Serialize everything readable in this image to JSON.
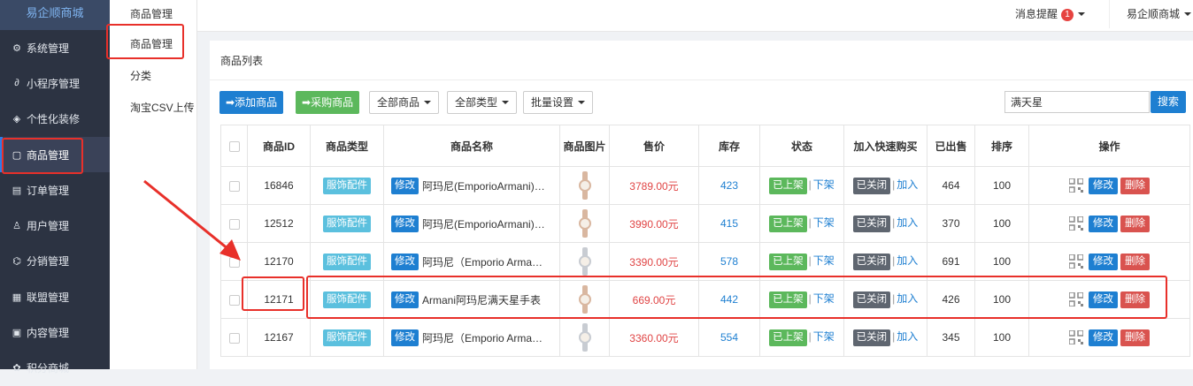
{
  "sidebar": {
    "logo": "易企顺商城",
    "items": [
      {
        "label": "系统管理",
        "icon": "gear-icon",
        "glyph": "⚙",
        "active": false
      },
      {
        "label": "小程序管理",
        "icon": "link-icon",
        "glyph": "∂",
        "active": false
      },
      {
        "label": "个性化装修",
        "icon": "diamond-icon",
        "glyph": "◈",
        "active": false
      },
      {
        "label": "商品管理",
        "icon": "bag-icon",
        "glyph": "▢",
        "active": true
      },
      {
        "label": "订单管理",
        "icon": "clipboard-icon",
        "glyph": "▤",
        "active": false
      },
      {
        "label": "用户管理",
        "icon": "user-icon",
        "glyph": "♙",
        "active": false
      },
      {
        "label": "分销管理",
        "icon": "share-icon",
        "glyph": "⌬",
        "active": false
      },
      {
        "label": "联盟管理",
        "icon": "store-icon",
        "glyph": "▦",
        "active": false
      },
      {
        "label": "内容管理",
        "icon": "document-icon",
        "glyph": "▣",
        "active": false
      },
      {
        "label": "积分商城",
        "icon": "gift-icon",
        "glyph": "✿",
        "active": false
      }
    ]
  },
  "subnav": {
    "items": [
      "商品管理",
      "分类",
      "淘宝CSV上传"
    ]
  },
  "topbar": {
    "title": "商品管理",
    "notify_label": "消息提醒",
    "notify_count": "1",
    "account": "易企顺商城"
  },
  "main": {
    "title": "商品列表",
    "buttons": {
      "add": "添加商品",
      "purchase": "采购商品",
      "all_goods": "全部商品",
      "all_types": "全部类型",
      "batch": "批量设置"
    },
    "search": {
      "value": "满天星",
      "button": "搜索"
    }
  },
  "table": {
    "headers": [
      "",
      "商品ID",
      "商品类型",
      "商品名称",
      "商品图片",
      "售价",
      "库存",
      "状态",
      "加入快速购买",
      "已出售",
      "排序",
      "操作"
    ],
    "status_on": "已上架",
    "action_off": "下架",
    "quick_closed": "已关闭",
    "action_add": "加入",
    "edit": "修改",
    "delete": "删除",
    "rows": [
      {
        "id": "16846",
        "type": "服饰配件",
        "name": "阿玛尼(EmporioArmani)女士手表",
        "price": "3789.00元",
        "stock": "423",
        "sold": "464",
        "sort": "100",
        "watch": "rose"
      },
      {
        "id": "12512",
        "type": "服饰配件",
        "name": "阿玛尼(EmporioArmani)女士手表",
        "price": "3990.00元",
        "stock": "415",
        "sold": "370",
        "sort": "100",
        "watch": "rose"
      },
      {
        "id": "12170",
        "type": "服饰配件",
        "name": "阿玛尼（Emporio Armani）女士手表",
        "price": "3390.00元",
        "stock": "578",
        "sold": "691",
        "sort": "100",
        "watch": "silver"
      },
      {
        "id": "12171",
        "type": "服饰配件",
        "name": "Armani阿玛尼满天星手表",
        "price": "669.00元",
        "stock": "442",
        "sold": "426",
        "sort": "100",
        "watch": "rose"
      },
      {
        "id": "12167",
        "type": "服饰配件",
        "name": "阿玛尼（Emporio Armani）女士手表",
        "price": "3360.00元",
        "stock": "554",
        "sold": "345",
        "sort": "100",
        "watch": "silver"
      }
    ]
  },
  "colors": {
    "sidebar_bg": "#2c3342",
    "primary": "#1e7fd1",
    "green": "#5cb85c",
    "price_red": "#e04444",
    "annotation_red": "#e8302a",
    "rose_gold": "#d9b7a0",
    "silver": "#c8ccd2"
  }
}
